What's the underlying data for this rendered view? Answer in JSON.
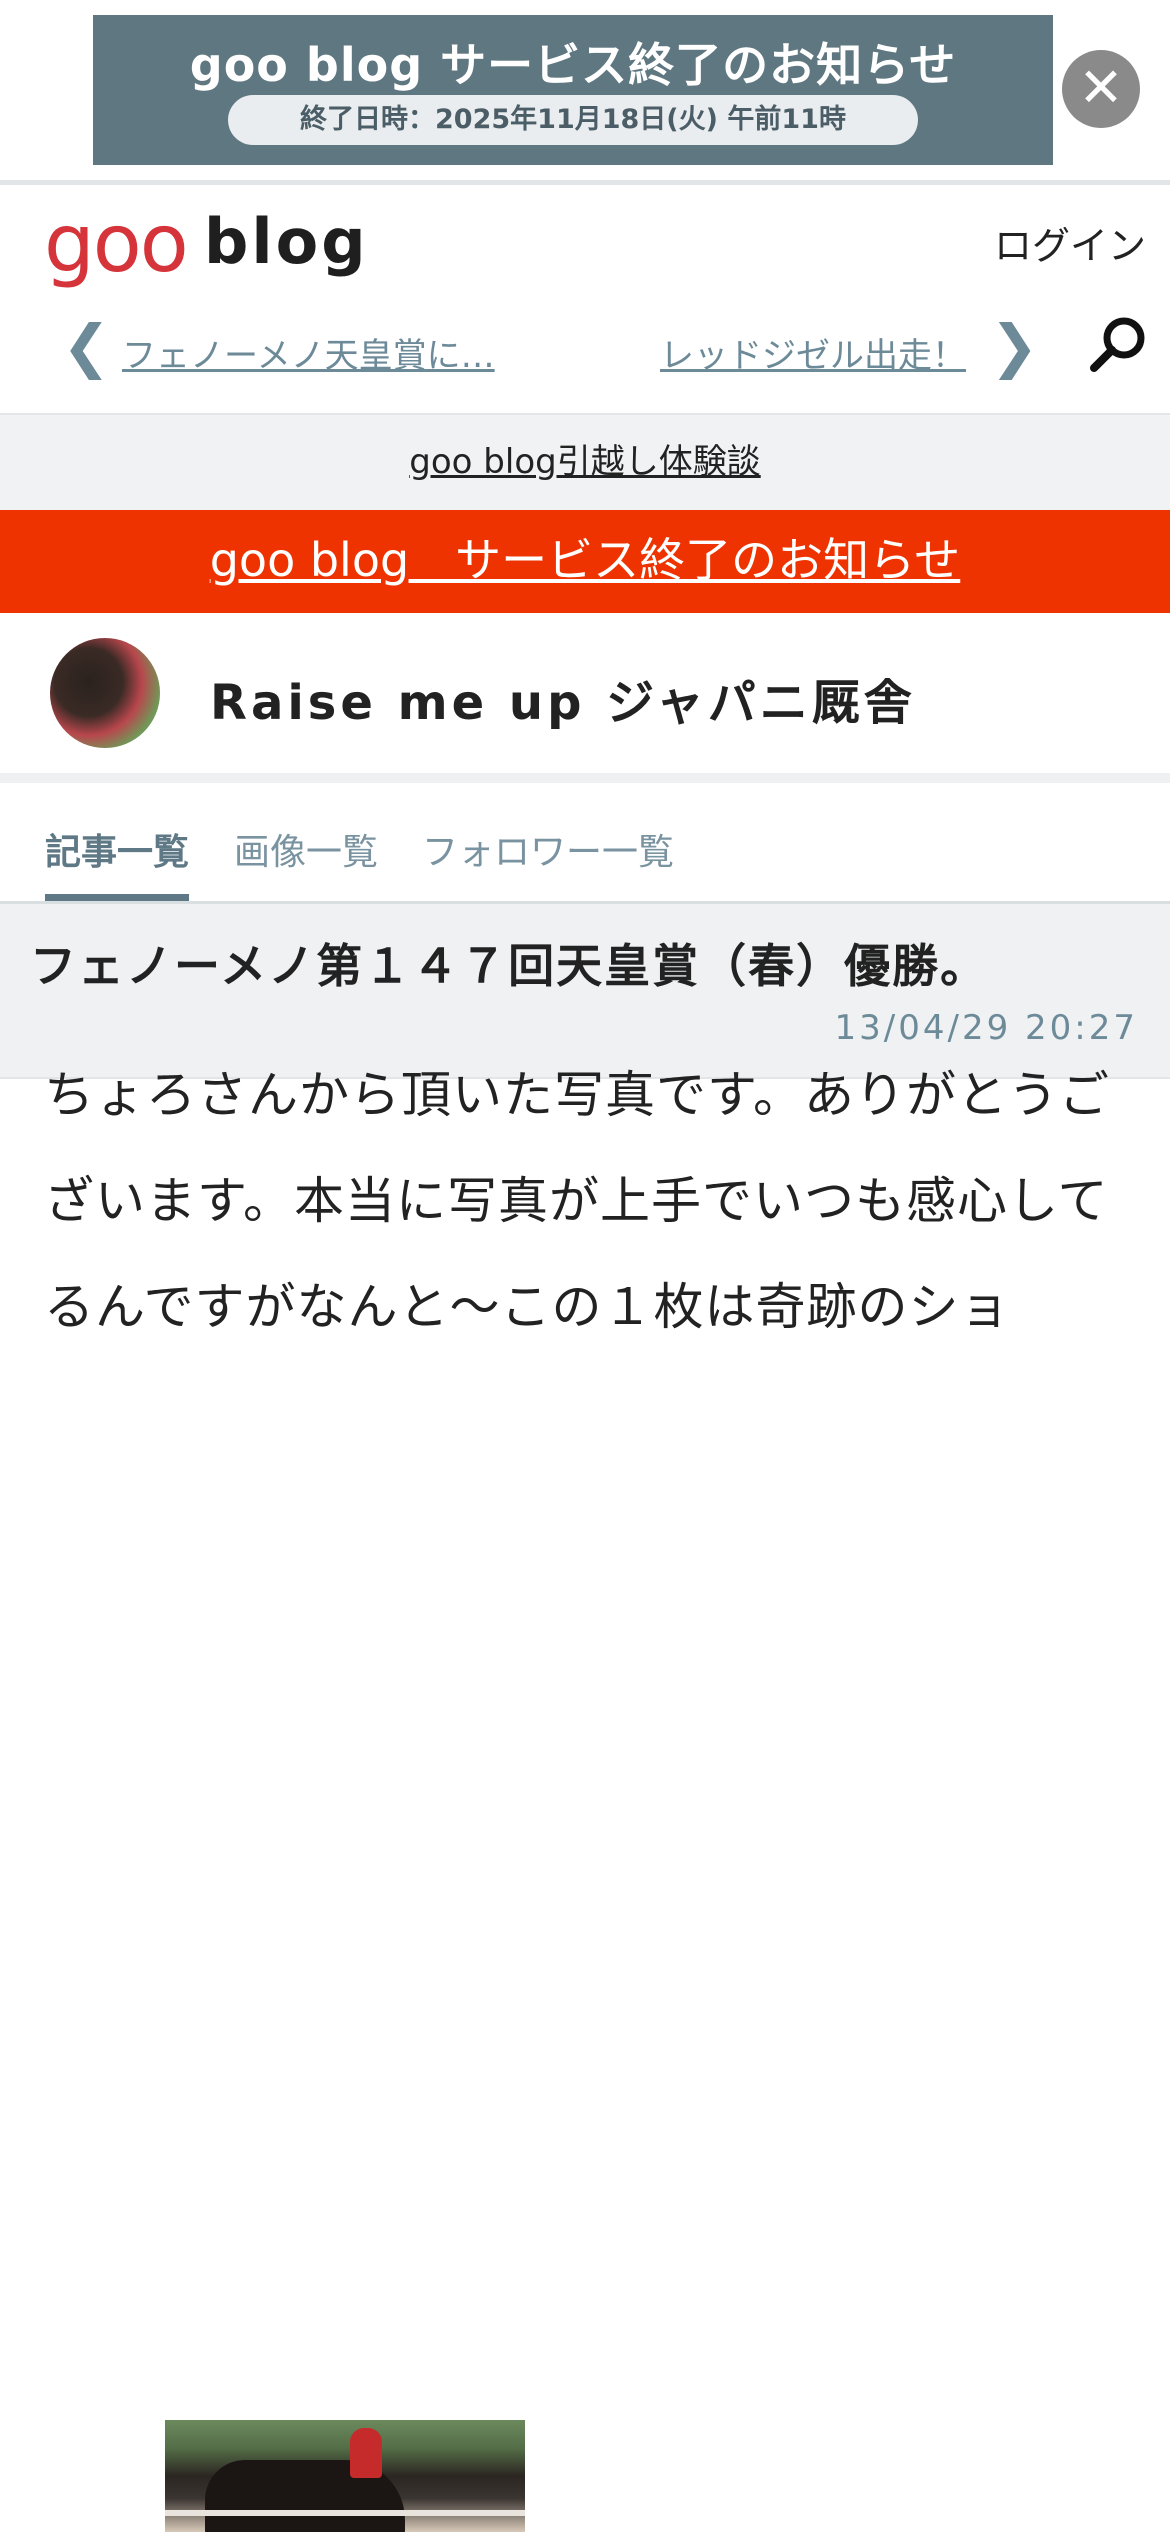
{
  "banner": {
    "title": "goo blog サービス終了のお知らせ",
    "end_date": "終了日時：2025年11月18日(火) 午前11時",
    "close_symbol": "✕"
  },
  "header": {
    "logo_goo": "goo",
    "logo_blog": "blog",
    "login": "ログイン",
    "prev_article": "フェノーメノ天皇賞に…",
    "next_article": "レッドジゼル出走！",
    "icons": [
      "chevron-left-icon",
      "chevron-right-icon",
      "search-icon"
    ]
  },
  "move_banner": "goo blog引越し体験談",
  "notice": "goo blog　サービス終了のお知らせ",
  "blog": {
    "title": "Raise me up ジャパニ厩舎"
  },
  "tabs": [
    {
      "label": "記事一覧",
      "active": true
    },
    {
      "label": "画像一覧",
      "active": false
    },
    {
      "label": "フォロワー一覧",
      "active": false
    }
  ],
  "article": {
    "title": "フェノーメノ第１４７回天皇賞（春）優勝。",
    "date": "13/04/29 20:27",
    "body": "ちょろさんから頂いた写真です。ありがとうございます。本当に写真が上手でいつも感心してるんですがなんと〜この１枚は奇跡のショ"
  },
  "colors": {
    "accent": "#6d8a99",
    "notice_red": "#ee3300",
    "logo_red": "#d5343a",
    "banner_bg": "#5f7781"
  }
}
